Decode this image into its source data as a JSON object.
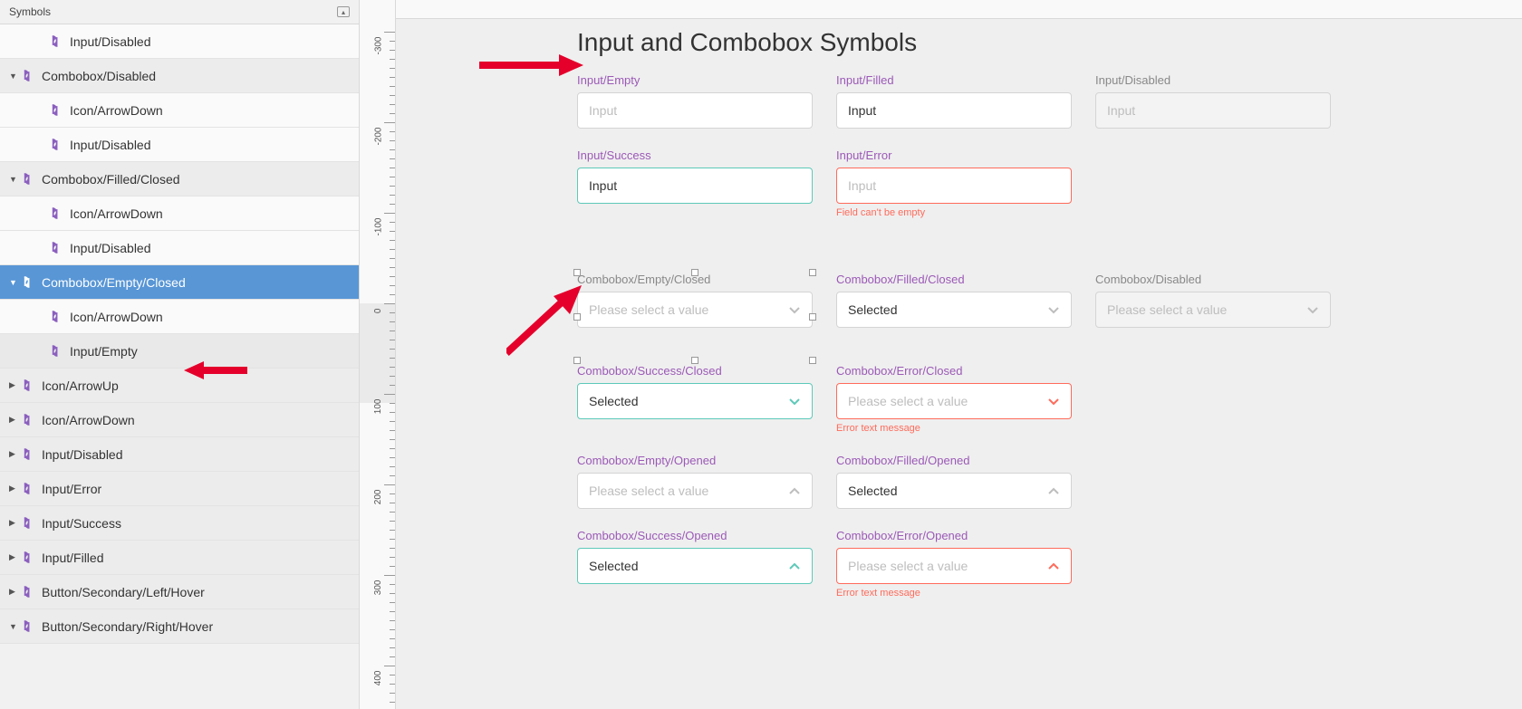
{
  "sidebar": {
    "title": "Symbols",
    "items": [
      {
        "label": "Input/Disabled",
        "depth": 1,
        "caret": "",
        "sel": false
      },
      {
        "label": "Combobox/Disabled",
        "depth": 0,
        "caret": "▼",
        "sel": false
      },
      {
        "label": "Icon/ArrowDown",
        "depth": 1,
        "caret": "",
        "sel": false
      },
      {
        "label": "Input/Disabled",
        "depth": 1,
        "caret": "",
        "sel": false
      },
      {
        "label": "Combobox/Filled/Closed",
        "depth": 0,
        "caret": "▼",
        "sel": false
      },
      {
        "label": "Icon/ArrowDown",
        "depth": 1,
        "caret": "",
        "sel": false
      },
      {
        "label": "Input/Disabled",
        "depth": 1,
        "caret": "",
        "sel": false
      },
      {
        "label": "Combobox/Empty/Closed",
        "depth": 0,
        "caret": "▼",
        "sel": true
      },
      {
        "label": "Icon/ArrowDown",
        "depth": 1,
        "caret": "",
        "sel": false
      },
      {
        "label": "Input/Empty",
        "depth": 1,
        "caret": "",
        "sel": false,
        "hover": true
      },
      {
        "label": "Icon/ArrowUp",
        "depth": 0,
        "caret": "▶",
        "sel": false
      },
      {
        "label": "Icon/ArrowDown",
        "depth": 0,
        "caret": "▶",
        "sel": false
      },
      {
        "label": "Input/Disabled",
        "depth": 0,
        "caret": "▶",
        "sel": false
      },
      {
        "label": "Input/Error",
        "depth": 0,
        "caret": "▶",
        "sel": false
      },
      {
        "label": "Input/Success",
        "depth": 0,
        "caret": "▶",
        "sel": false
      },
      {
        "label": "Input/Filled",
        "depth": 0,
        "caret": "▶",
        "sel": false
      },
      {
        "label": "Button/Secondary/Left/Hover",
        "depth": 0,
        "caret": "▶",
        "sel": false
      },
      {
        "label": "Button/Secondary/Right/Hover",
        "depth": 0,
        "caret": "▼",
        "sel": false
      }
    ]
  },
  "ruler_labels": [
    "-300",
    "-200",
    "-100",
    "0",
    "100",
    "200",
    "300",
    "400"
  ],
  "canvas": {
    "title": "Input and Combobox Symbols",
    "inputs": {
      "empty": {
        "label": "Input/Empty",
        "placeholder": "Input"
      },
      "filled": {
        "label": "Input/Filled",
        "value": "Input"
      },
      "disabled": {
        "label": "Input/Disabled",
        "placeholder": "Input"
      },
      "success": {
        "label": "Input/Success",
        "value": "Input"
      },
      "error": {
        "label": "Input/Error",
        "placeholder": "Input",
        "help": "Field can't be empty"
      }
    },
    "combos": {
      "empty_closed": {
        "label": "Combobox/Empty/Closed",
        "placeholder": "Please select a value"
      },
      "filled_closed": {
        "label": "Combobox/Filled/Closed",
        "value": "Selected"
      },
      "disabled": {
        "label": "Combobox/Disabled",
        "placeholder": "Please select a value"
      },
      "success_closed": {
        "label": "Combobox/Success/Closed",
        "value": "Selected"
      },
      "error_closed": {
        "label": "Combobox/Error/Closed",
        "placeholder": "Please select a value",
        "help": "Error text message"
      },
      "empty_opened": {
        "label": "Combobox/Empty/Opened",
        "placeholder": "Please select a value"
      },
      "filled_opened": {
        "label": "Combobox/Filled/Opened",
        "value": "Selected"
      },
      "success_opened": {
        "label": "Combobox/Success/Opened",
        "value": "Selected"
      },
      "error_opened": {
        "label": "Combobox/Error/Opened",
        "placeholder": "Please select a value",
        "help": "Error text message"
      }
    }
  }
}
